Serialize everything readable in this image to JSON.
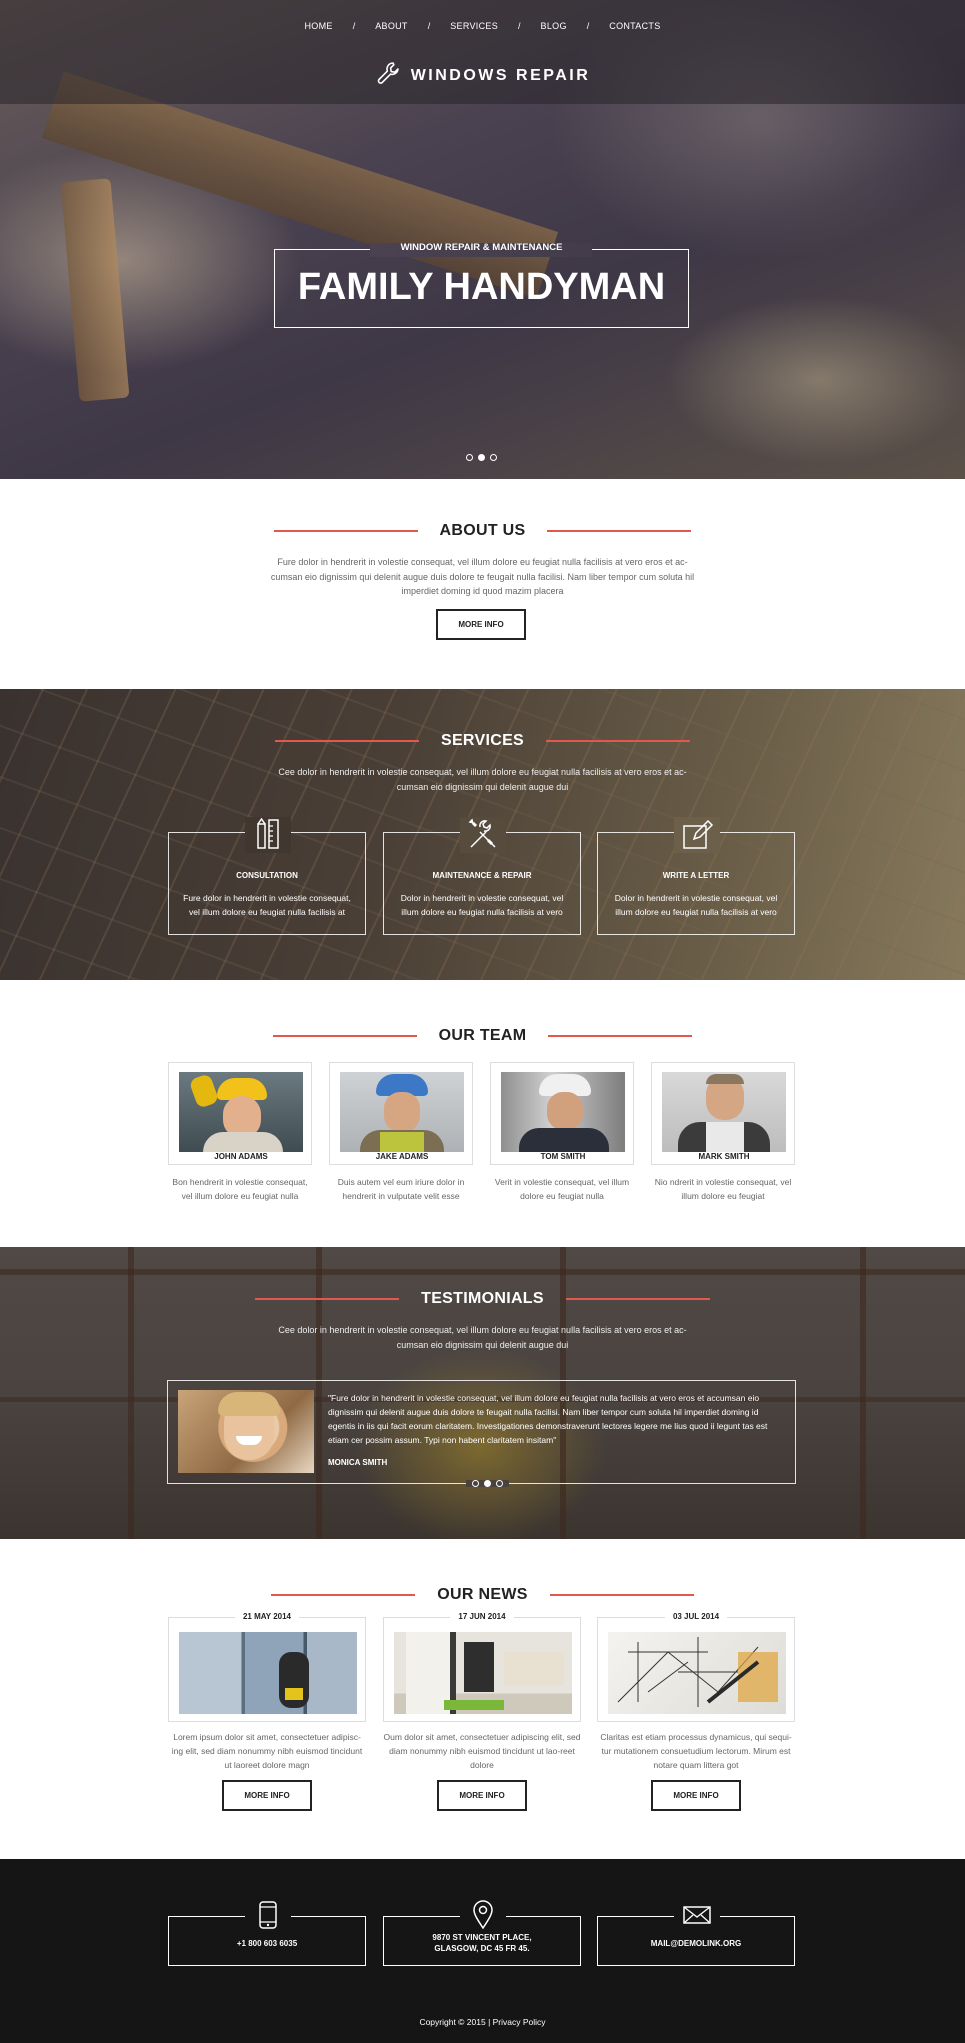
{
  "nav": {
    "items": [
      "HOME",
      "ABOUT",
      "SERVICES",
      "BLOG",
      "CONTACTS"
    ],
    "separator": "/"
  },
  "logo": {
    "text": "WINDOWS REPAIR",
    "icon": "wrench-icon"
  },
  "hero": {
    "subtitle": "WINDOW REPAIR & MAINTENANCE",
    "title": "FAMILY HANDYMAN",
    "slides": 3,
    "active_slide": 2
  },
  "about": {
    "heading": "ABOUT US",
    "text": "Fure dolor in hendrerit in volestie consequat, vel illum dolore eu feugiat nulla facilisis at vero eros et ac-cumsan eio dignissim qui  delenit augue duis dolore te feugait nulla facilisi. Nam liber tempor cum soluta hil imperdiet doming id quod mazim placera",
    "button": "MORE INFO"
  },
  "services": {
    "heading": "SERVICES",
    "text": "Cee dolor in hendrerit in volestie consequat, vel illum dolore eu feugiat nulla facilisis at vero eros et ac-cumsan eio dignissim qui  delenit augue dui",
    "items": [
      {
        "title": "CONSULTATION",
        "text": "Fure dolor in hendrerit in volestie consequat, vel illum dolore eu feugiat nulla facilisis at",
        "icon": "pencil-ruler-icon"
      },
      {
        "title": "MAINTENANCE & REPAIR",
        "text": "Dolor in hendrerit in volestie consequat, vel illum dolore eu feugiat nulla facilisis at vero",
        "icon": "tools-icon"
      },
      {
        "title": "WRITE A LETTER",
        "text": "Dolor in hendrerit in volestie consequat, vel illum dolore eu feugiat nulla facilisis at vero",
        "icon": "edit-icon"
      }
    ]
  },
  "team": {
    "heading": "OUR TEAM",
    "members": [
      {
        "name": "JOHN ADAMS",
        "text": "Bon hendrerit in volestie consequat, vel illum dolore eu feugiat nulla"
      },
      {
        "name": "JAKE ADAMS",
        "text": "Duis autem vel eum iriure dolor in hendrerit in vulputate velit esse"
      },
      {
        "name": "TOM SMITH",
        "text": "Verit in volestie consequat, vel illum dolore eu feugiat nulla"
      },
      {
        "name": "MARK SMITH",
        "text": "Nio ndrerit in volestie consequat, vel illum dolore eu feugiat"
      }
    ]
  },
  "testimonials": {
    "heading": "TESTIMONIALS",
    "text": "Cee dolor in hendrerit in volestie consequat, vel illum dolore eu feugiat nulla facilisis at vero eros et ac-cumsan eio dignissim qui  delenit augue dui",
    "quote": "\"Fure dolor in hendrerit in volestie consequat, vel illum dolore eu feugiat nulla facilisis at vero eros et accumsan eio dignissim qui  delenit augue duis dolore te feugait nulla facilisi. Nam liber tempor cum soluta hil imperdiet doming id egentis in iis qui facit eorum claritatem. Investigationes demonstraverunt lectores legere me lius quod ii legunt tas est etiam cer possim assum. Typi non habent claritatem insitam\"",
    "author": "MONICA SMITH",
    "slides": 3,
    "active_slide": 2
  },
  "news": {
    "heading": "OUR NEWS",
    "items": [
      {
        "date": "21 MAY 2014",
        "text": "Lorem ipsum dolor sit amet, consectetuer adipisc-ing elit, sed diam nonummy nibh euismod tincidunt ut laoreet dolore magn",
        "button": "MORE INFO"
      },
      {
        "date": "17 JUN 2014",
        "text": "Oum dolor sit amet, consectetuer adipiscing elit, sed diam nonummy nibh euismod tincidunt ut lao-reet dolore",
        "button": "MORE INFO"
      },
      {
        "date": "03 JUL 2014",
        "text": "Claritas est etiam processus dynamicus, qui sequi-tur mutationem consuetudium lectorum. Mirum est notare quam littera got",
        "button": "MORE INFO"
      }
    ]
  },
  "footer": {
    "phone": "+1 800 603 6035",
    "address_line1": "9870 ST VINCENT PLACE,",
    "address_line2": "GLASGOW, DC 45 FR 45.",
    "email": "MAIL@DEMOLINK.ORG",
    "copyright": "Copyright © 2015 | Privacy Policy"
  },
  "colors": {
    "accent": "#e0584e",
    "dark": "#151515"
  }
}
